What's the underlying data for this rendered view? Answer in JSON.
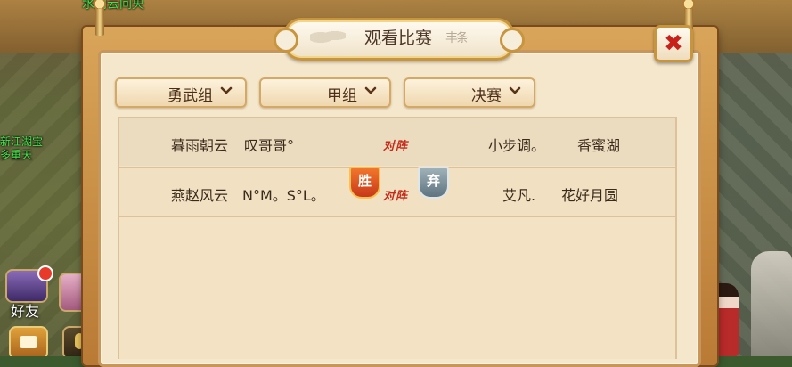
{
  "background": {
    "top_text": "水门云间央",
    "npc_text_lines": [
      "新江湖宝",
      "多重天",
      "乖"
    ],
    "friend_label": "好友",
    "world_label": "世"
  },
  "dialog": {
    "title": "观看比赛",
    "title_decoration": "丰条",
    "close_label": "✖",
    "filters": [
      {
        "label": "勇武组"
      },
      {
        "label": "甲组"
      },
      {
        "label": "决赛"
      }
    ],
    "vs_label": "对阵",
    "matches": [
      {
        "left": [
          "暮雨朝云",
          "叹哥哥°"
        ],
        "right": [
          "小步调。",
          "香蜜湖"
        ],
        "left_result": "",
        "right_result": ""
      },
      {
        "left": [
          "燕赵风云",
          "N°M。S°L。"
        ],
        "right": [
          "艾凡.",
          "花好月圆"
        ],
        "left_result": "胜",
        "right_result": "弃"
      }
    ]
  },
  "colors": {
    "accent_red": "#c32a1a",
    "win_badge": "#e05a22",
    "forfeit_badge": "#7d919a"
  }
}
